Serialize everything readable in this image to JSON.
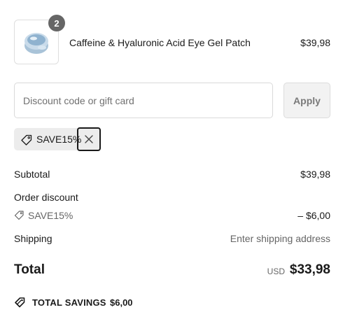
{
  "product": {
    "name": "Caffeine & Hyaluronic Acid Eye Gel Patch",
    "price": "$39,98",
    "quantity": "2",
    "image_icon": "eye-gel-jar-icon"
  },
  "discount": {
    "placeholder": "Discount code or gift card",
    "value": "",
    "apply_label": "Apply",
    "applied_code": "SAVE15%"
  },
  "summary": {
    "subtotal_label": "Subtotal",
    "subtotal_value": "$39,98",
    "order_discount_label": "Order discount",
    "discount_code": "SAVE15%",
    "discount_value": "– $6,00",
    "shipping_label": "Shipping",
    "shipping_value": "Enter shipping address",
    "total_label": "Total",
    "total_currency": "USD",
    "total_value": "$33,98",
    "savings_label": "TOTAL SAVINGS",
    "savings_value": "$6,00"
  },
  "colors": {
    "text": "#1a1a1a",
    "muted": "#666666",
    "badge": "#666666",
    "chip_bg": "#ececec",
    "button_bg": "#f2f2f2"
  }
}
